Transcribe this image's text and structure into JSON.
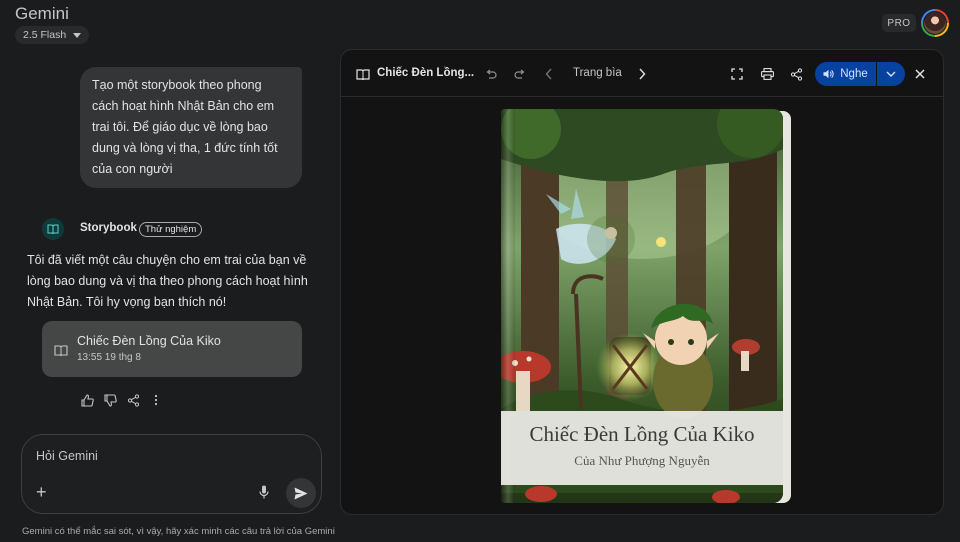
{
  "app": {
    "title": "Gemini",
    "model": "2.5 Flash",
    "pro_badge": "PRO"
  },
  "chat": {
    "user_message": "Tạo một storybook theo phong cách hoạt hình Nhật Bản cho em trai tôi. Để giáo dục về lòng bao dung và lòng vị tha, 1 đức tính tốt của con người",
    "assistant": {
      "name": "Storybook",
      "tag": "Thử nghiệm",
      "reply": "Tôi đã viết một câu chuyện cho em trai của bạn về lòng bao dung và vị tha theo phong cách hoạt hình Nhật Bản. Tôi hy vọng bạn thích nó!",
      "card": {
        "title": "Chiếc Đèn Lồng Của Kiko",
        "date": "13:55 19 thg 8"
      }
    }
  },
  "input": {
    "placeholder": "Hỏi Gemini"
  },
  "disclaimer": "Gemini có thể mắc sai sót, vì vậy, hãy xác minh các câu trả lời của Gemini",
  "canvas": {
    "title": "Chiếc Đèn Lồng...",
    "page_label": "Trang bìa",
    "listen_label": "Nghe",
    "cover": {
      "title": "Chiếc Đèn Lồng Của Kiko",
      "author": "Của Như Phượng Nguyễn"
    }
  },
  "colors": {
    "accent": "#0842a0",
    "background": "#1b1c1d",
    "bubble": "#333537",
    "card": "#444746"
  },
  "icons": [
    "book-icon",
    "undo-icon",
    "redo-icon",
    "chevron-left-icon",
    "chevron-right-icon",
    "fullscreen-icon",
    "print-icon",
    "share-icon",
    "speaker-icon",
    "chevron-down-icon",
    "close-icon",
    "thumbs-up-icon",
    "thumbs-down-icon",
    "more-icon",
    "plus-icon",
    "mic-icon",
    "send-icon"
  ]
}
